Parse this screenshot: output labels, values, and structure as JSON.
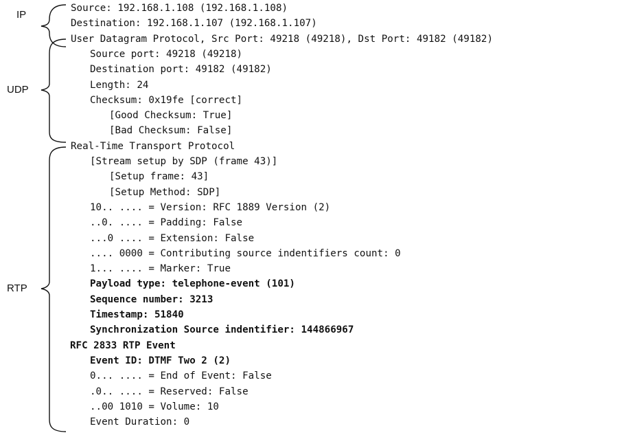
{
  "groups": {
    "ip": "IP",
    "udp": "UDP",
    "rtp": "RTP"
  },
  "lines": [
    {
      "text": "Source: 192.168.1.108 (192.168.1.108)",
      "bold": false
    },
    {
      "text": "Destination: 192.168.1.107 (192.168.1.107)",
      "bold": false
    },
    {
      "text": "User Datagram Protocol, Src Port: 49218 (49218), Dst Port: 49182 (49182)",
      "bold": false
    },
    {
      "text": "Source port: 49218 (49218)",
      "bold": false
    },
    {
      "text": "Destination port: 49182 (49182)",
      "bold": false
    },
    {
      "text": "Length: 24",
      "bold": false
    },
    {
      "text": "Checksum: 0x19fe [correct]",
      "bold": false
    },
    {
      "text": "[Good Checksum: True]",
      "bold": false
    },
    {
      "text": "[Bad Checksum: False]",
      "bold": false
    },
    {
      "text": "Real-Time Transport Protocol",
      "bold": false
    },
    {
      "text": "[Stream setup by SDP (frame 43)]",
      "bold": false
    },
    {
      "text": "[Setup frame: 43]",
      "bold": false
    },
    {
      "text": "[Setup Method: SDP]",
      "bold": false
    },
    {
      "text": "10.. .... = Version: RFC 1889 Version (2)",
      "bold": false
    },
    {
      "text": "..0. .... = Padding: False",
      "bold": false
    },
    {
      "text": "...0 .... = Extension: False",
      "bold": false
    },
    {
      "text": ".... 0000 = Contributing source indentifiers count: 0",
      "bold": false
    },
    {
      "text": "1... .... = Marker: True",
      "bold": false
    },
    {
      "text": "Payload type: telephone-event (101)",
      "bold": true
    },
    {
      "text": "Sequence number: 3213",
      "bold": true
    },
    {
      "text": "Timestamp: 51840",
      "bold": true
    },
    {
      "text": "Synchronization Source indentifier: 144866967",
      "bold": true
    },
    {
      "text": "RFC 2833 RTP Event",
      "bold": true
    },
    {
      "text": "Event ID: DTMF Two 2 (2)",
      "bold": true
    },
    {
      "text": "0... .... = End of Event: False",
      "bold": false
    },
    {
      "text": ".0.. .... = Reserved: False",
      "bold": false
    },
    {
      "text": "..00 1010 = Volume: 10",
      "bold": false
    },
    {
      "text": "Event Duration: 0",
      "bold": false
    }
  ]
}
